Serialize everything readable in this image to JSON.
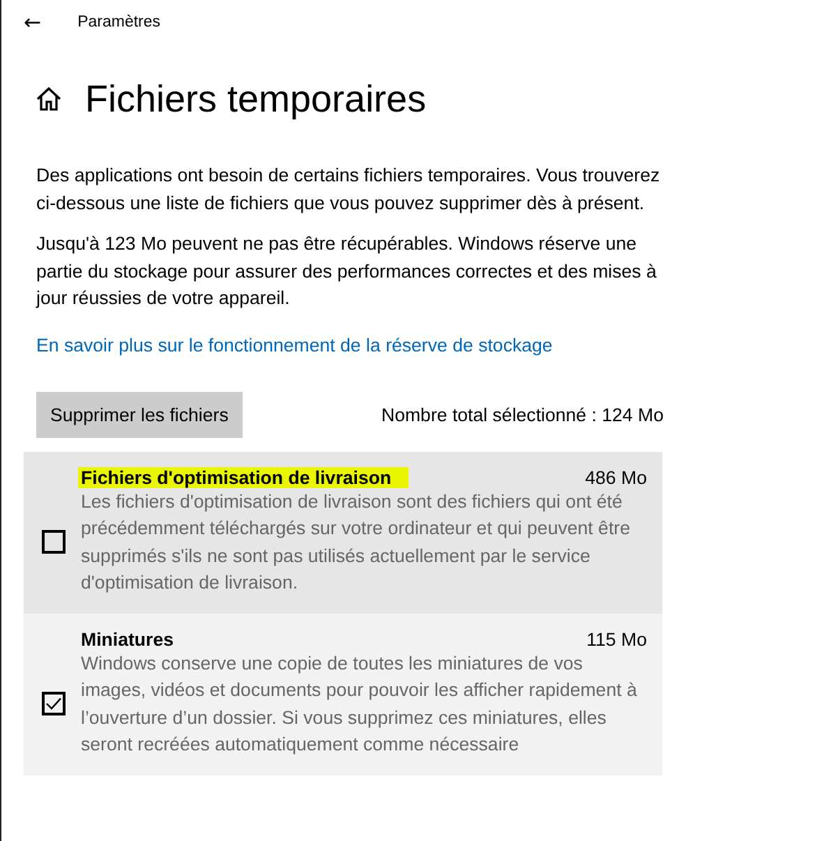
{
  "header": {
    "back": "←",
    "app_title": "Paramètres"
  },
  "page": {
    "title": "Fichiers temporaires"
  },
  "paragraphs": [
    "Des applications ont besoin de certains fichiers temporaires. Vous trouverez ci-dessous une liste de fichiers que vous pouvez supprimer dès à présent.",
    "Jusqu'à 123 Mo peuvent ne pas être récupérables. Windows réserve une partie du stockage pour assurer des performances correctes et des mises à jour réussies de votre appareil."
  ],
  "link": "En savoir plus sur le fonctionnement de la réserve de stockage",
  "delete_button": "Supprimer les fichiers",
  "total": "Nombre total sélectionné : 124 Mo",
  "items": [
    {
      "name": "Fichiers d'optimisation de livraison",
      "size": "486 Mo",
      "description": "Les fichiers d'optimisation de livraison sont des fichiers qui ont été précédemment téléchargés sur votre ordinateur et qui peuvent être supprimés s'ils ne sont pas utilisés actuellement par le service d'optimisation de livraison.",
      "checked": false,
      "hovered": true,
      "highlighted": true
    },
    {
      "name": "Miniatures",
      "size": "115 Mo",
      "description": "Windows conserve une copie de toutes les miniatures de vos images, vidéos et documents pour pouvoir les afficher rapidement à l’ouverture d’un dossier. Si vous supprimez ces miniatures, elles seront recréées automatiquement comme nécessaire",
      "checked": true,
      "hovered": false,
      "highlighted": false
    }
  ]
}
